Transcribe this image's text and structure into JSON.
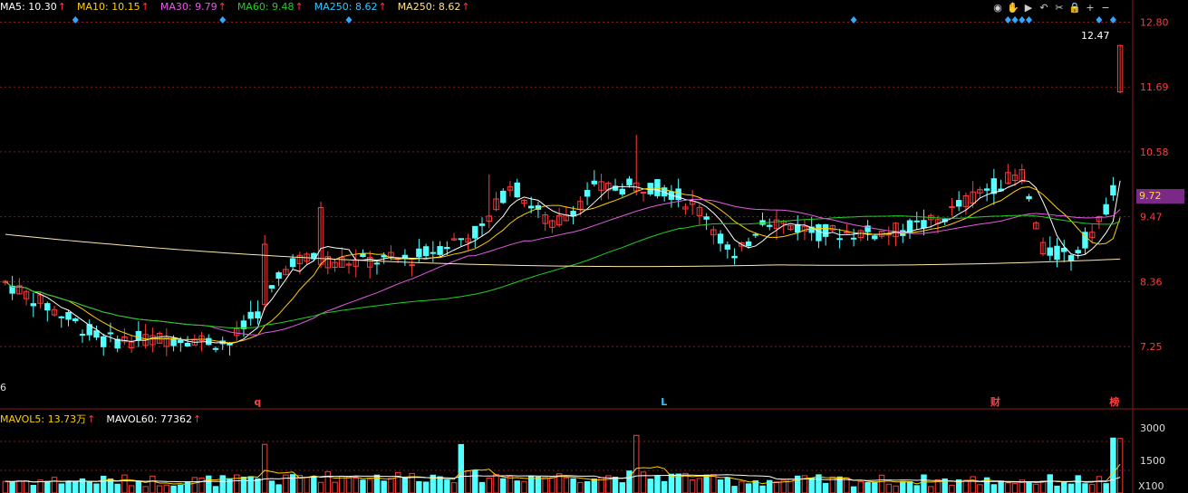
{
  "ma_legend": [
    {
      "label": "MA5: 10.30",
      "color": "#ffffff"
    },
    {
      "label": "MA10: 10.15",
      "color": "#ffd000"
    },
    {
      "label": "MA30: 9.79",
      "color": "#e65ce6"
    },
    {
      "label": "MA60: 9.48",
      "color": "#1fd21f"
    },
    {
      "label": "MA250: 8.62",
      "color": "#33c7ff"
    },
    {
      "label": "MA250: 8.62",
      "color": "#ffe08a"
    }
  ],
  "vol_legend": [
    {
      "label": "MAVOL5: 13.73万",
      "color": "#ffd000"
    },
    {
      "label": "MAVOL60: 77362",
      "color": "#ffffff"
    }
  ],
  "up_arrow": "↑",
  "toolbar_icons": [
    "eye-icon",
    "hand-icon",
    "play-icon",
    "undo-icon",
    "scissors-icon",
    "lock-icon",
    "zoom-in-icon",
    "zoom-out-icon"
  ],
  "toolbar_glyphs": [
    "◉",
    "✋",
    "▶",
    "↶",
    "✂",
    "🔒",
    "+",
    "−"
  ],
  "left_edge_label": "6",
  "chart_data": {
    "type": "candlestick",
    "y_axis_ticks": [
      "12.80",
      "11.69",
      "10.58",
      "9.47",
      "8.36",
      "7.25"
    ],
    "ylim": [
      6.2,
      12.9
    ],
    "current_price": "9.72",
    "peak_label": "12.47",
    "volume_axis_ticks": [
      "3000",
      "1500"
    ],
    "volume_unit": "X100",
    "volume_ylim": [
      0,
      3300
    ],
    "event_markers": [
      {
        "index": 36,
        "text": "q",
        "color": "#ff4040"
      },
      {
        "index": 94,
        "text": "L",
        "color": "#33c7ff"
      },
      {
        "index": 141,
        "text": "财",
        "color": "#ff4040"
      },
      {
        "index": 158,
        "text": "榜",
        "color": "#ff4040"
      }
    ],
    "diamond_markers": [
      10,
      31,
      49,
      121,
      143,
      144,
      145,
      146,
      156,
      158
    ],
    "colors": {
      "up": "#ff3b3b",
      "down": "#54ffff",
      "grid": "#8a1b1b",
      "axis_text": "#ff3b3b"
    }
  }
}
